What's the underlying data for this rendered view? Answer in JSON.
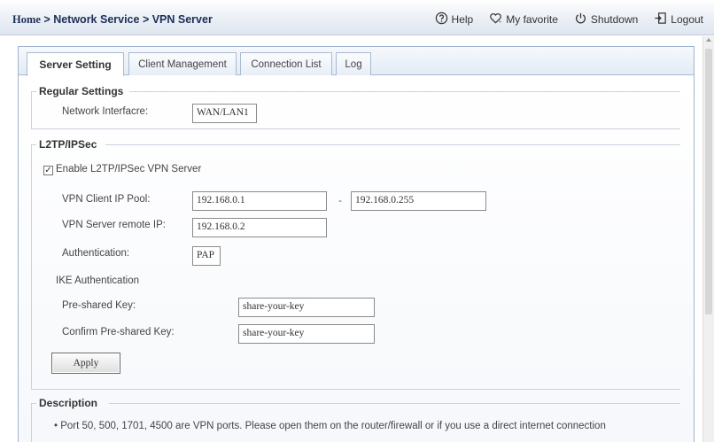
{
  "breadcrumb": {
    "home": "Home",
    "sep1": " > ",
    "section": "Network Service",
    "sep2": " > ",
    "page": "VPN Server"
  },
  "topnav": {
    "help": "Help",
    "favorite": "My favorite",
    "shutdown": "Shutdown",
    "logout": "Logout"
  },
  "tabs": [
    {
      "label": "Server Setting",
      "active": true
    },
    {
      "label": "Client Management",
      "active": false
    },
    {
      "label": "Connection List",
      "active": false
    },
    {
      "label": "Log",
      "active": false
    }
  ],
  "regular": {
    "title": "Regular Settings",
    "interface_label": "Network Interfacre:",
    "interface_value": "WAN/LAN1"
  },
  "l2tp": {
    "title": "L2TP/IPSec",
    "enable_label": "Enable L2TP/IPSec VPN Server",
    "enable_checked": true,
    "pool_label": "VPN Client IP Pool:",
    "pool_start": "192.168.0.1",
    "pool_sep": "-",
    "pool_end": "192.168.0.255",
    "remote_label": "VPN Server remote IP:",
    "remote_value": "192.168.0.2",
    "auth_label": "Authentication:",
    "auth_value": "PAP",
    "ike_label": "IKE Authentication",
    "psk_label": "Pre-shared Key:",
    "psk_value": "share-your-key",
    "confirm_label": "Confirm Pre-shared Key:",
    "confirm_value": "share-your-key",
    "apply_label": "Apply"
  },
  "description": {
    "title": "Description",
    "line1": "• Port 50, 500, 1701, 4500 are VPN ports. Please open them on the router/firewall or if you use a direct internet connection"
  }
}
